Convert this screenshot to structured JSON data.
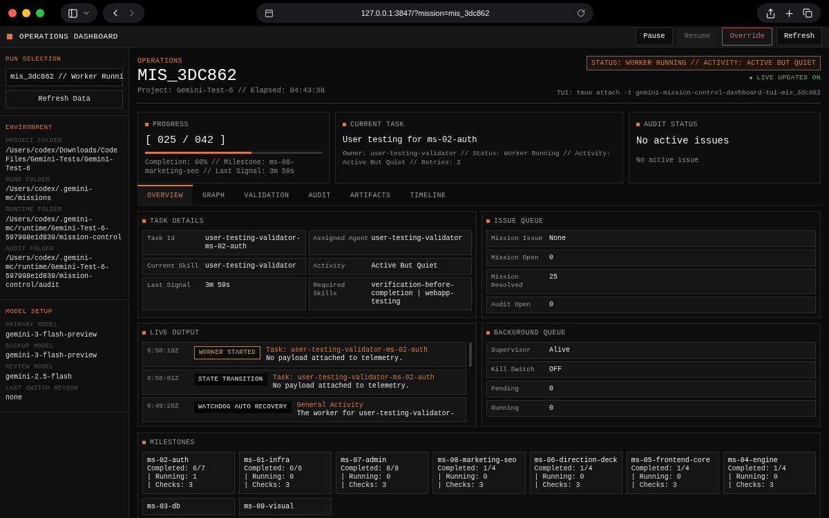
{
  "browser": {
    "url": "127.0.0.1:3847/?mission=mis_3dc862"
  },
  "header": {
    "title": "OPERATIONS DASHBOARD",
    "buttons": [
      {
        "label": "Pause",
        "kind": "normal",
        "disabled": false
      },
      {
        "label": "Resume",
        "kind": "normal",
        "disabled": true
      },
      {
        "label": "Override",
        "kind": "danger",
        "disabled": false
      },
      {
        "label": "Refresh",
        "kind": "normal",
        "disabled": false
      }
    ]
  },
  "sidebar": {
    "run_selection": {
      "title": "RUN SELECTION",
      "value": "mis_3dc862 // Worker Runni",
      "button": "Refresh Data"
    },
    "sections": [
      {
        "title": "ENVIRONMENT",
        "fields": [
          {
            "label": "PROJECT FOLDER",
            "value": "/Users/codex/Downloads/Code Files/Gemini-Tests/Gemini-Test-6"
          },
          {
            "label": "RUNS FOLDER",
            "value": "/Users/codex/.gemini-mc/missions"
          },
          {
            "label": "RUNTIME FOLDER",
            "value": "/Users/codex/.gemini-mc/runtime/Gemini-Test-6-597998e1d839/mission-control"
          },
          {
            "label": "AUDIT FOLDER",
            "value": "/Users/codex/.gemini-mc/runtime/Gemini-Test-6-597998e1d839/mission-control/audit"
          }
        ]
      },
      {
        "title": "MODEL SETUP",
        "fields": [
          {
            "label": "PRIMARY MODEL",
            "value": "gemini-3-flash-preview"
          },
          {
            "label": "BACKUP MODEL",
            "value": "gemini-3-flash-preview"
          },
          {
            "label": "REVIEW MODEL",
            "value": "gemini-2.5-flash"
          },
          {
            "label": "LAST SWITCH REASON",
            "value": "none"
          }
        ]
      }
    ]
  },
  "main": {
    "eyebrow": "OPERATIONS",
    "title": "MIS_3DC862",
    "subtitle": "Project: Gemini-Test-6 // Elapsed: 04:43:38",
    "status": "STATUS: WORKER RUNNING // ACTIVITY: ACTIVE BUT QUIET",
    "live": {
      "label": "LIVE UPDATES ON",
      "on": true
    },
    "tui": "TUI: tmux attach -t gemini-mission-control-dashboard-tui-mis_3dc862"
  },
  "progress": {
    "title": "PROGRESS",
    "count": "[ 025 / 042 ]",
    "level": 0.6,
    "detail": "Completion: 60% // Milestone: ms-08-marketing-seo // Last Signal: 3m 59s"
  },
  "current_task": {
    "title": "CURRENT TASK",
    "heading": "User testing for ms-02-auth",
    "detail": "Owner: user-testing-validator // Status: Worker Running // Activity: Active But Quiet // Retries: 2"
  },
  "audit_status": {
    "title": "AUDIT STATUS",
    "heading": "No active issues",
    "detail": "No active issue"
  },
  "tabs": [
    {
      "label": "OVERVIEW",
      "selected": true
    },
    {
      "label": "GRAPH",
      "selected": false
    },
    {
      "label": "VALIDATION",
      "selected": false
    },
    {
      "label": "AUDIT",
      "selected": false
    },
    {
      "label": "ARTIFACTS",
      "selected": false
    },
    {
      "label": "TIMELINE",
      "selected": false
    }
  ],
  "task_details": {
    "title": "TASK DETAILS",
    "rows": [
      {
        "label": "Task Id",
        "value": "user-testing-validator-ms-02-auth"
      },
      {
        "label": "Assigned Agent",
        "value": "user-testing-validator"
      },
      {
        "label": "Current Skill",
        "value": "user-testing-validator"
      },
      {
        "label": "Activity",
        "value": "Active But Quiet"
      },
      {
        "label": "Last Signal",
        "value": "3m 59s"
      },
      {
        "label": "Required Skills",
        "value": "verification-before-completion | webapp-testing"
      }
    ]
  },
  "issue_queue": {
    "title": "ISSUE QUEUE",
    "rows": [
      {
        "label": "Mission Issue",
        "value": "None"
      },
      {
        "label": "Mission Open",
        "value": "0"
      },
      {
        "label": "Mission Resolved",
        "value": "25"
      },
      {
        "label": "Audit Open",
        "value": "0"
      }
    ]
  },
  "live_output": {
    "title": "LIVE OUTPUT",
    "entries": [
      {
        "time": "6:50:19Z",
        "event": "WORKER STARTED",
        "kind": "highlight",
        "subject": "Task: user-testing-validator-ms-02-auth",
        "message": "No payload attached to telemetry."
      },
      {
        "time": "6:50:01Z",
        "event": "STATE TRANSITION",
        "kind": "plain",
        "subject": "Task: user-testing-validator-ms-02-auth",
        "message": "No payload attached to telemetry."
      },
      {
        "time": "6:49:28Z",
        "event": "WATCHDOG AUTO RECOVERY",
        "kind": "plain",
        "subject": "General Activity",
        "message": "The worker for user-testing-validator-"
      }
    ]
  },
  "background_queue": {
    "title": "BACKGROUND QUEUE",
    "rows": [
      {
        "label": "Supervisor",
        "value": "Alive"
      },
      {
        "label": "Kill Switch",
        "value": "OFF"
      },
      {
        "label": "Pending",
        "value": "0"
      },
      {
        "label": "Running",
        "value": "0"
      }
    ]
  },
  "milestones": {
    "title": "MILESTONES",
    "items": [
      {
        "name": "ms-02-auth",
        "completed": "Completed: 6/7",
        "running": "| Running: 1",
        "checks": "| Checks: 3"
      },
      {
        "name": "ms-01-infra",
        "completed": "Completed: 6/6",
        "running": "| Running: 0",
        "checks": "| Checks: 3"
      },
      {
        "name": "ms-07-admin",
        "completed": "Completed: 8/8",
        "running": "| Running: 0",
        "checks": "| Checks: 3"
      },
      {
        "name": "ms-08-marketing-seo",
        "completed": "Completed: 1/4",
        "running": "| Running: 0",
        "checks": "| Checks: 3"
      },
      {
        "name": "ms-06-direction-deck",
        "completed": "Completed: 1/4",
        "running": "| Running: 0",
        "checks": "| Checks: 3"
      },
      {
        "name": "ms-05-frontend-core",
        "completed": "Completed: 1/4",
        "running": "| Running: 0",
        "checks": "| Checks: 3"
      },
      {
        "name": "ms-04-engine",
        "completed": "Completed: 1/4",
        "running": "| Running: 0",
        "checks": "| Checks: 3"
      },
      {
        "name": "ms-03-db"
      },
      {
        "name": "ms-09-visual"
      }
    ]
  }
}
